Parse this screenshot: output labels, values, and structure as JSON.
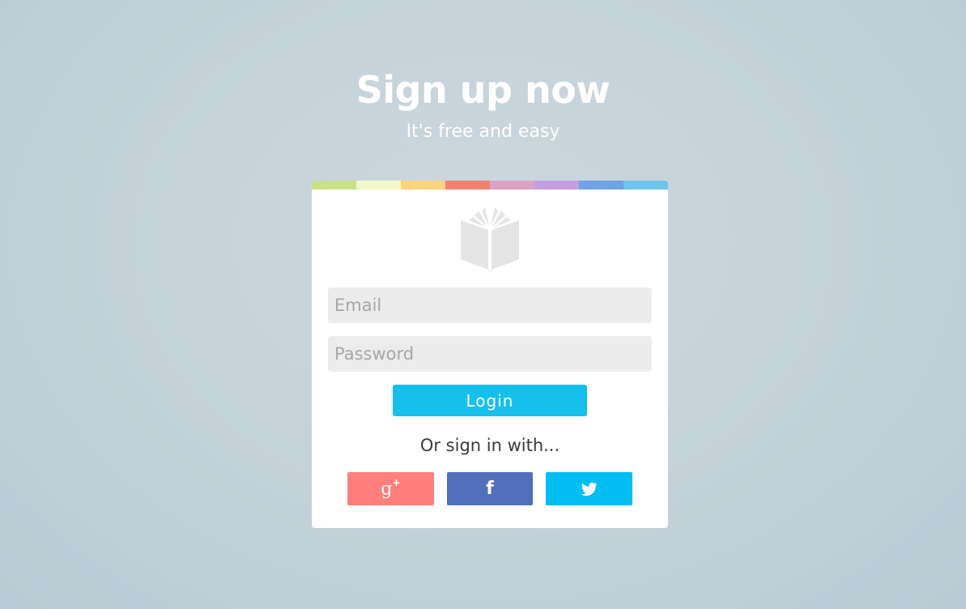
{
  "header": {
    "title": "Sign up now",
    "subtitle": "It's free and easy"
  },
  "brand": {
    "stripe_colors": [
      "#c8e087",
      "#f2f9c8",
      "#fcd27c",
      "#f4806f",
      "#dca2c4",
      "#c49ee0",
      "#6fa2e6",
      "#6cc6ec"
    ],
    "logo_icon": "open-book-icon",
    "logo_color": "#e5e5e5"
  },
  "form": {
    "email_placeholder": "Email",
    "password_placeholder": "Password",
    "login_label": "Login",
    "login_color": "#16c0ec"
  },
  "social": {
    "prompt": "Or sign in with...",
    "buttons": [
      {
        "name": "google-plus",
        "icon": "google-plus-icon",
        "glyph": "g",
        "color": "#ff7f7c"
      },
      {
        "name": "facebook",
        "icon": "facebook-icon",
        "glyph": "f",
        "color": "#526fbb"
      },
      {
        "name": "twitter",
        "icon": "twitter-icon",
        "glyph": "",
        "color": "#03bef2"
      }
    ]
  }
}
